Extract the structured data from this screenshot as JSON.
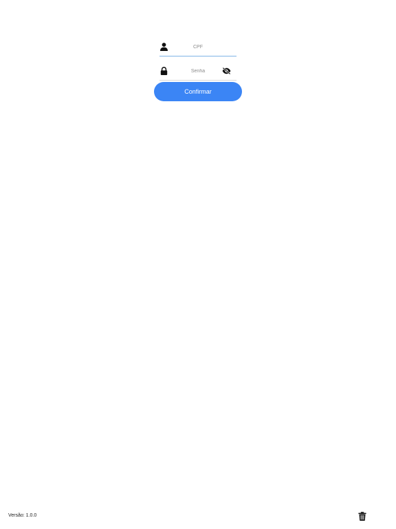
{
  "login": {
    "cpf_placeholder": "CPF",
    "cpf_value": "",
    "password_placeholder": "Senha",
    "password_value": "",
    "confirm_label": "Confirmar"
  },
  "icons": {
    "cpf_field": "user-icon",
    "password_field": "lock-icon",
    "password_visibility": "eye-slash-icon",
    "clear_data": "trash-icon"
  },
  "footer": {
    "version_label": "Versão: 1.0.0"
  },
  "colors": {
    "primary": "#3b85f5",
    "active_underline": "#7fb3e6",
    "background": "#ffffff"
  }
}
